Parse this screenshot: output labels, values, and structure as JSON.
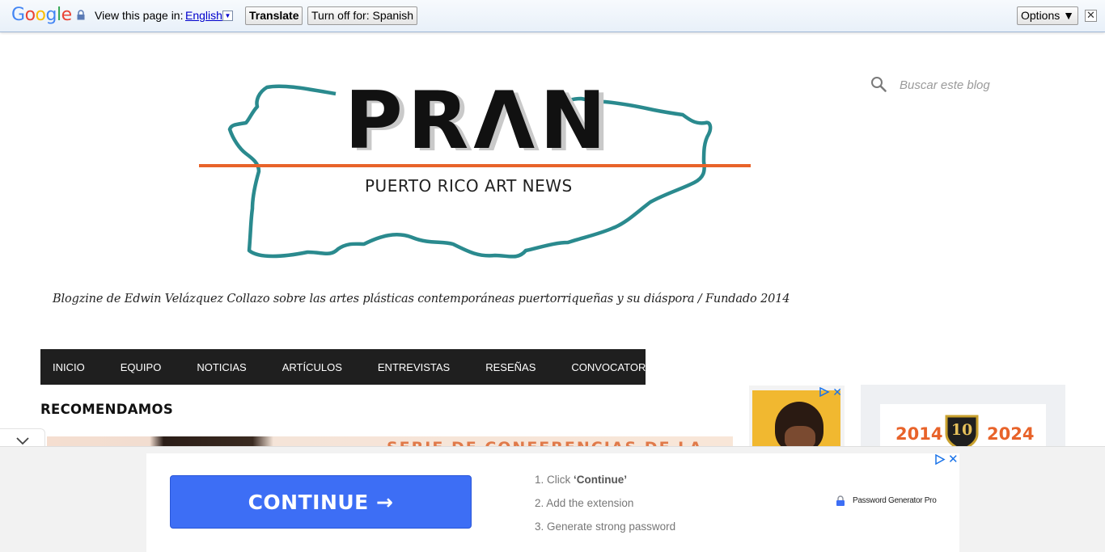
{
  "translate_bar": {
    "logo": "Google",
    "view_label": "View this page in:",
    "language": "English",
    "language_dropdown_icon": "dropdown-arrow-icon",
    "translate_button": "Translate",
    "turn_off_button": "Turn off for: Spanish",
    "options_button": "Options ▼",
    "close_icon": "✕"
  },
  "header": {
    "logo_text": "PRΛN",
    "logo_subtitle": "PUERTO RICO ART NEWS",
    "colors": {
      "island_outline": "#2a8a8e",
      "stripe": "#e8632a",
      "logo_text": "#111111"
    },
    "search_placeholder": "Buscar este blog",
    "tagline": "Blogzine de Edwin Velázquez Collazo sobre las artes plásticas contemporáneas puertorriqueñas y su diáspora / Fundado 2014"
  },
  "nav": {
    "items": [
      "INICIO",
      "EQUIPO",
      "NOTICIAS",
      "ARTÍCULOS",
      "ENTREVISTAS",
      "RESEÑAS",
      "CONVOCATORIAS"
    ]
  },
  "main": {
    "section_title": "RECOMENDAMOS",
    "featured_text": "SERIE DE CONFERENCIAS DE LA"
  },
  "sidebar": {
    "anniversary_start": "2014",
    "anniversary_end": "2024",
    "anniversary_badge": "10"
  },
  "bottom_ad": {
    "continue_label": "CONTINUE →",
    "steps": [
      {
        "num": "1.",
        "pre": "Click ",
        "bold": "‘Continue’"
      },
      {
        "num": "2.",
        "pre": "Add the extension",
        "bold": ""
      },
      {
        "num": "3.",
        "pre": "Generate strong password",
        "bold": ""
      }
    ],
    "brand": "Password Generator Pro"
  }
}
